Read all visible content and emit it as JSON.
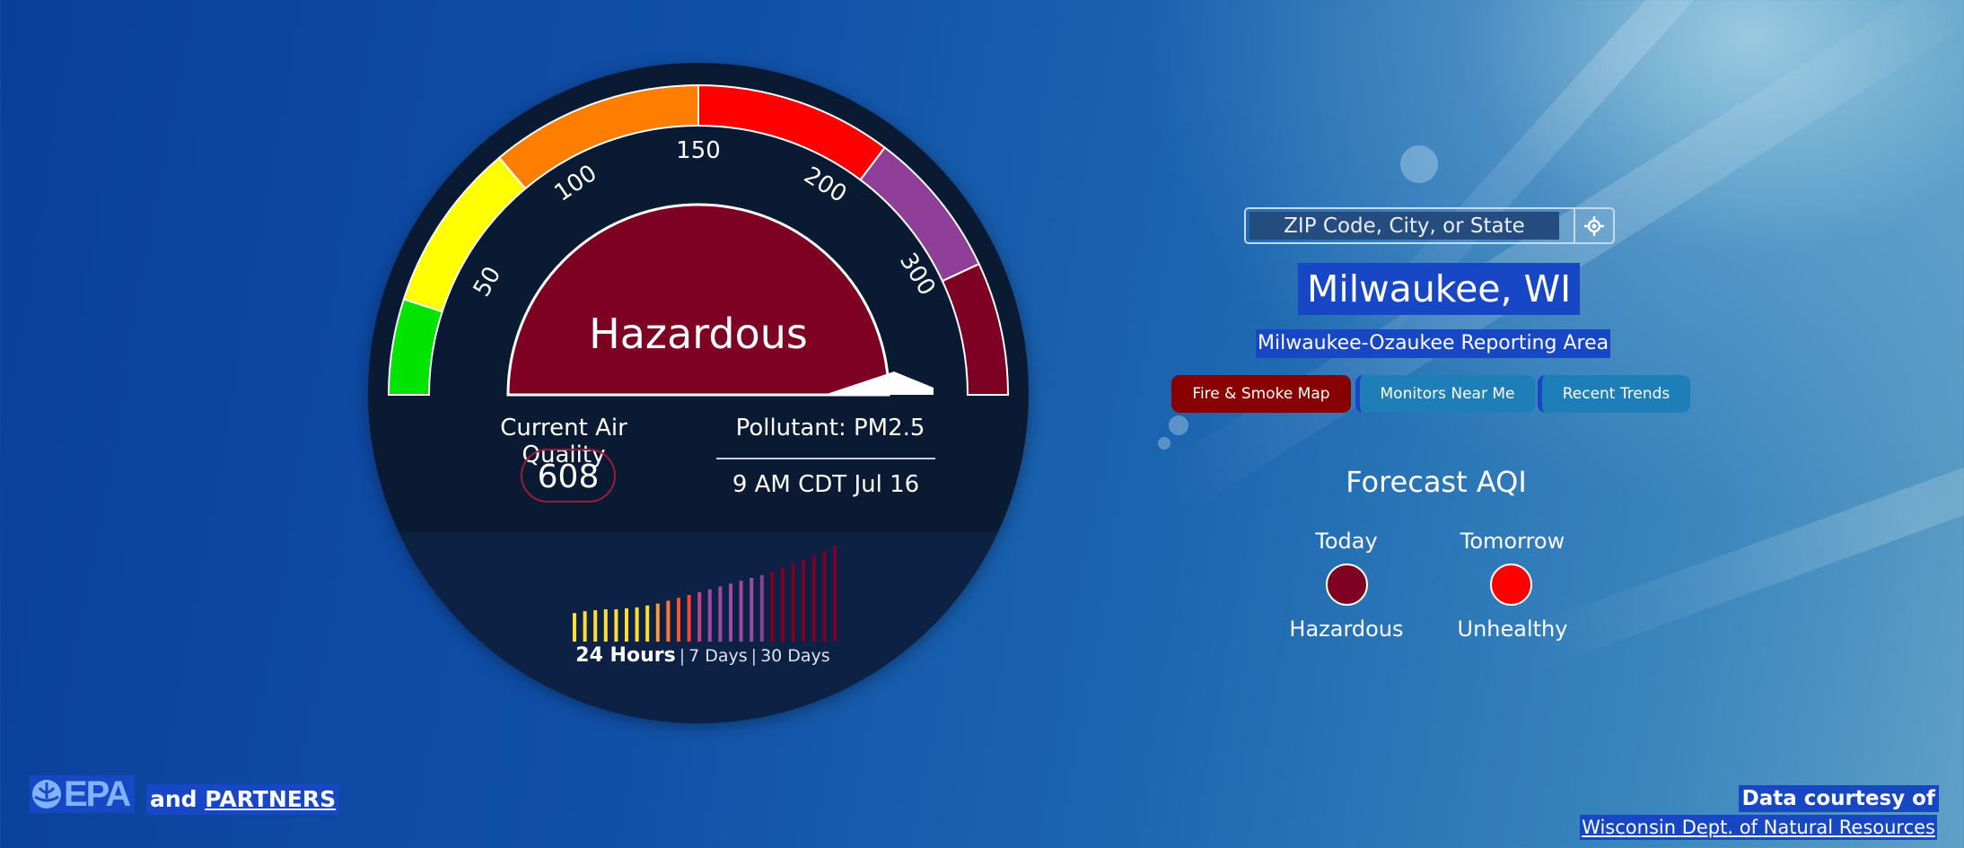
{
  "gauge": {
    "tick_labels": [
      "50",
      "100",
      "150",
      "200",
      "300"
    ],
    "category": "Hazardous",
    "current_label": "Current Air Quality",
    "aqi_value": "608",
    "pollutant": "Pollutant: PM2.5",
    "timestamp": "9 AM CDT Jul 16",
    "colors": {
      "good": "#00e400",
      "moderate": "#ffff00",
      "usg": "#ff7e00",
      "unhealthy": "#ff0000",
      "very_unhealthy": "#8f3f97",
      "hazardous": "#7e0023"
    },
    "history": {
      "levels": [
        30,
        32,
        33,
        34,
        34,
        35,
        36,
        38,
        40,
        43,
        46,
        49,
        52,
        55,
        58,
        61,
        64,
        67,
        70,
        74,
        78,
        82,
        86,
        90,
        95,
        100
      ],
      "colors": [
        "#ffdd33",
        "#ffdd33",
        "#ffdd33",
        "#ffdd33",
        "#ffdd33",
        "#ffdd33",
        "#ffdd33",
        "#ffdd33",
        "#ff9933",
        "#ff7733",
        "#ff5533",
        "#ff4433",
        "#c0428a",
        "#9d4aa3",
        "#9d4aa3",
        "#9d4aa3",
        "#9d4aa3",
        "#9d4aa3",
        "#8f3f97",
        "#7e0023",
        "#7e0023",
        "#7e0023",
        "#7e0023",
        "#7e0023",
        "#7e0023",
        "#7e0023"
      ]
    },
    "range_active": "24 Hours",
    "range_options": [
      "7 Days",
      "30 Days"
    ]
  },
  "search": {
    "placeholder": "ZIP Code, City, or State"
  },
  "location": {
    "city": "Milwaukee, WI",
    "area": "Milwaukee-Ozaukee Reporting Area"
  },
  "tabs": {
    "fire": "Fire & Smoke Map",
    "monitors": "Monitors Near Me",
    "trends": "Recent Trends"
  },
  "forecast": {
    "title": "Forecast AQI",
    "today_label": "Today",
    "today_category": "Hazardous",
    "today_color": "#7e0023",
    "tomorrow_label": "Tomorrow",
    "tomorrow_category": "Unhealthy",
    "tomorrow_color": "#ff0000"
  },
  "footer": {
    "logo_text": "EPA",
    "and_text": "and",
    "partners_link": "PARTNERS",
    "courtesy_text": "Data courtesy of",
    "courtesy_link": "Wisconsin Dept. of Natural Resources"
  }
}
